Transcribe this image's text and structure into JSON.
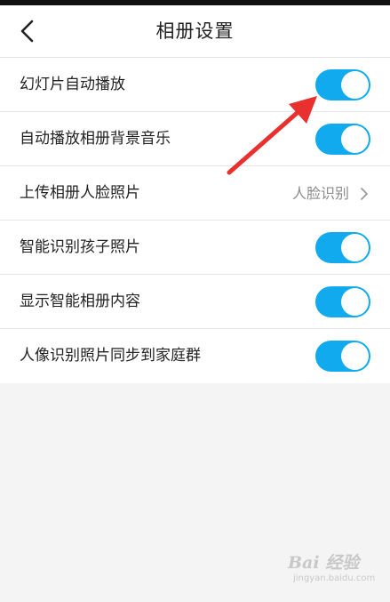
{
  "header": {
    "title": "相册设置",
    "back_icon": "chevron-left-icon"
  },
  "settings": [
    {
      "label": "幻灯片自动播放",
      "type": "toggle",
      "enabled": true
    },
    {
      "label": "自动播放相册背景音乐",
      "type": "toggle",
      "enabled": true
    },
    {
      "label": "上传相册人脸照片",
      "type": "link",
      "value": "人脸识别",
      "icon": "chevron-right-icon"
    },
    {
      "label": "智能识别孩子照片",
      "type": "toggle",
      "enabled": true
    },
    {
      "label": "显示智能相册内容",
      "type": "toggle",
      "enabled": true
    },
    {
      "label": "人像识别照片同步到家庭群",
      "type": "toggle",
      "enabled": true
    }
  ],
  "watermark": {
    "brand": "Bai 经验",
    "url": "jingyan.baidu.com"
  },
  "colors": {
    "toggle_on": "#12aaee",
    "annotation_arrow": "#e8302f",
    "background": "#f4f4f4"
  }
}
